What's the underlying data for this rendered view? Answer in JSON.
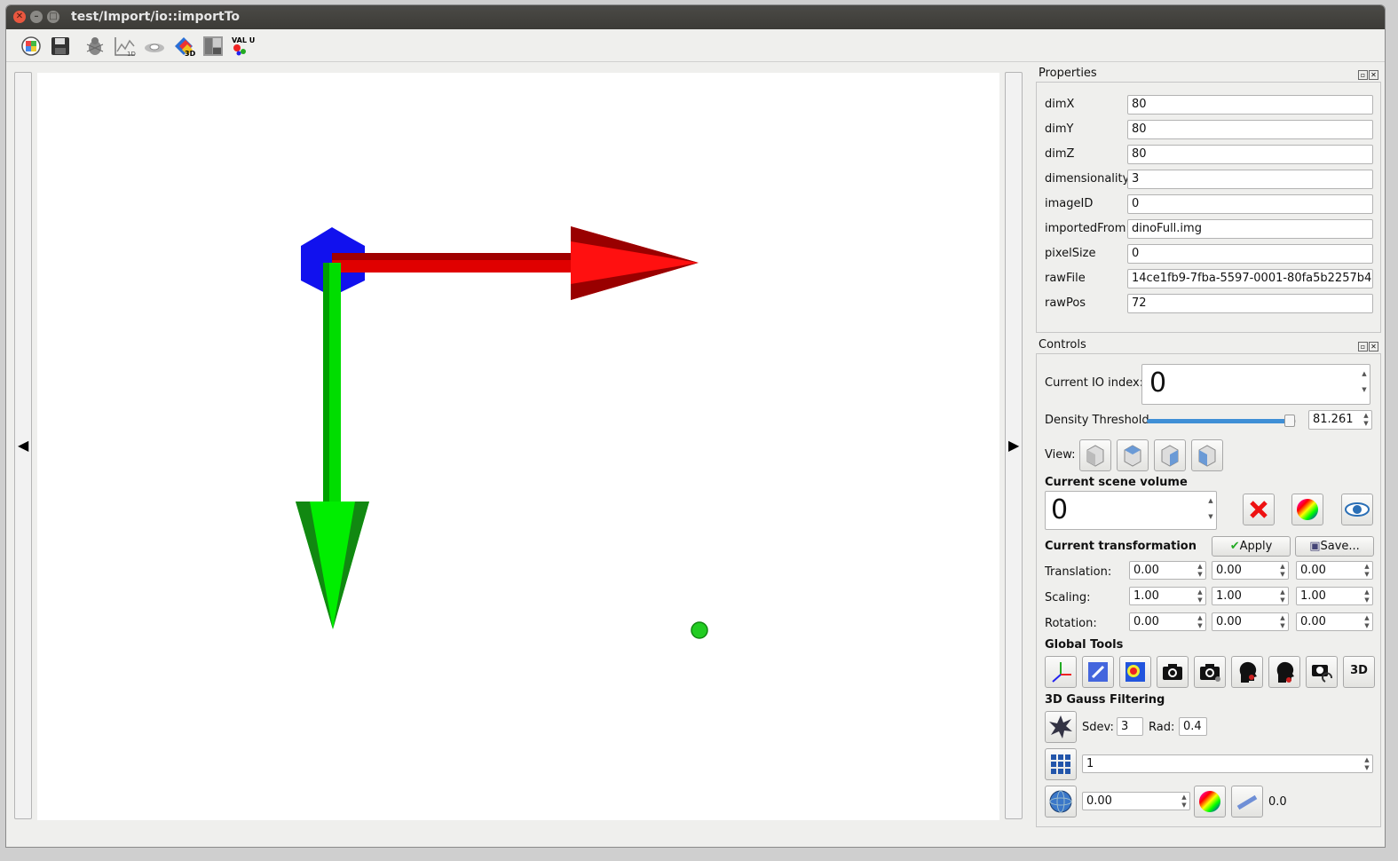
{
  "window": {
    "title": "test/Import/io::importTo"
  },
  "toolbar": {
    "icons": [
      "palette-icon",
      "save-icon",
      "bug-icon",
      "histogram-1d-icon",
      "scanner-icon",
      "3d-view-icon",
      "grayscale-image-icon",
      "values-icon"
    ],
    "values_label": "VAL UES"
  },
  "left_handle": {
    "arrow": "◀"
  },
  "right_handle": {
    "arrow": "▶"
  },
  "properties": {
    "title": "Properties",
    "rows": [
      {
        "label": "dimX",
        "value": "80"
      },
      {
        "label": "dimY",
        "value": "80"
      },
      {
        "label": "dimZ",
        "value": "80"
      },
      {
        "label": "dimensionality",
        "value": "3"
      },
      {
        "label": "imageID",
        "value": "0"
      },
      {
        "label": "importedFrom",
        "value": "dinoFull.img"
      },
      {
        "label": "pixelSize",
        "value": "0"
      },
      {
        "label": "rawFile",
        "value": "14ce1fb9-7fba-5597-0001-80fa5b2257b4"
      },
      {
        "label": "rawPos",
        "value": "72"
      }
    ]
  },
  "controls": {
    "title": "Controls",
    "io_index_label": "Current IO index:",
    "io_index_value": "0",
    "density_label": "Density Threshold",
    "density_value": "81.261",
    "density_fraction": 0.96,
    "view_label": "View:",
    "scene_volume_label": "Current scene volume",
    "scene_volume_value": "0",
    "transformation_label": "Current transformation",
    "apply_label": "Apply",
    "save_label": "Save...",
    "translation_label": "Translation:",
    "translation": [
      "0.00",
      "0.00",
      "0.00"
    ],
    "scaling_label": "Scaling:",
    "scaling": [
      "1.00",
      "1.00",
      "1.00"
    ],
    "rotation_label": "Rotation:",
    "rotation": [
      "0.00",
      "0.00",
      "0.00"
    ],
    "global_tools_label": "Global Tools",
    "gauss_label": "3D Gauss Filtering",
    "sdev_label": "Sdev:",
    "sdev_value": "3",
    "rad_label": "Rad:",
    "rad_value": "0.4",
    "grid_value": "1",
    "sphere_value": "0.00",
    "sphere_readout": "0.0",
    "threed_label": "3D"
  },
  "colors": {
    "x_axis": "#ff0000",
    "y_axis": "#00ee00",
    "origin": "#1010ee",
    "point": "#22cc22",
    "slider": "#3f8fd6"
  }
}
